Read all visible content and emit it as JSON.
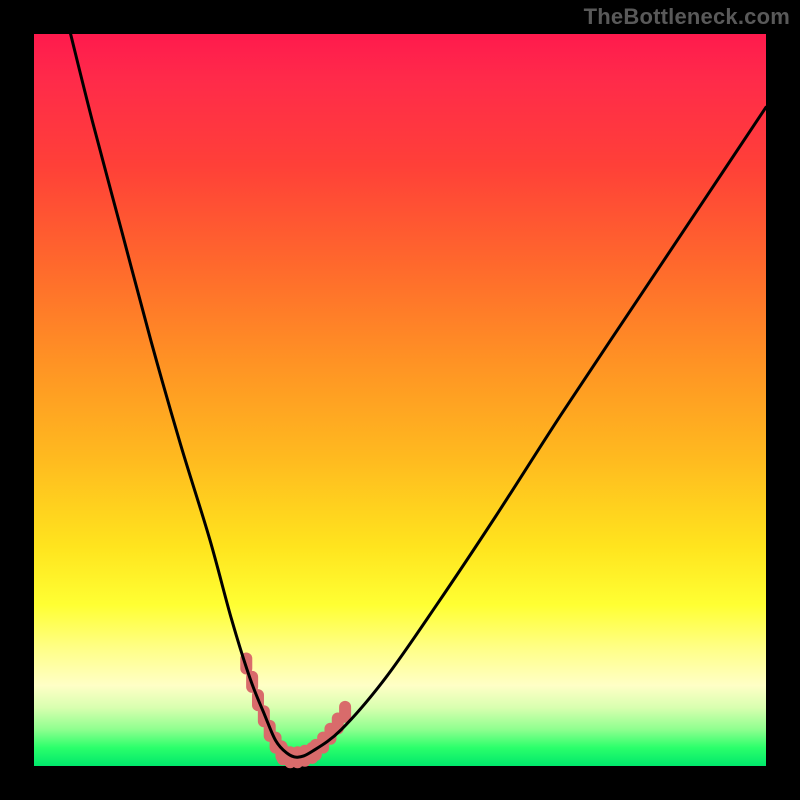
{
  "watermark": "TheBottleneck.com",
  "chart_data": {
    "type": "line",
    "title": "",
    "xlabel": "",
    "ylabel": "",
    "xlim": [
      0,
      100
    ],
    "ylim": [
      0,
      100
    ],
    "series": [
      {
        "name": "bottleneck-curve",
        "x": [
          5,
          8,
          12,
          16,
          20,
          24,
          27,
          29.5,
          31.5,
          33,
          34.5,
          36,
          38,
          42,
          48,
          55,
          63,
          72,
          82,
          92,
          100
        ],
        "y": [
          100,
          88,
          73,
          58,
          44,
          31,
          20,
          12,
          7,
          3.5,
          1.8,
          1.2,
          2.0,
          5,
          12,
          22,
          34,
          48,
          63,
          78,
          90
        ]
      }
    ],
    "markers": [
      {
        "name": "highlight-left-arm",
        "points": [
          {
            "x": 29.0,
            "y": 14.0
          },
          {
            "x": 29.8,
            "y": 11.5
          },
          {
            "x": 30.6,
            "y": 9.0
          },
          {
            "x": 31.4,
            "y": 6.8
          },
          {
            "x": 32.2,
            "y": 4.8
          },
          {
            "x": 33.0,
            "y": 3.2
          },
          {
            "x": 33.8,
            "y": 2.0
          }
        ]
      },
      {
        "name": "highlight-bottom",
        "points": [
          {
            "x": 34.0,
            "y": 1.6
          },
          {
            "x": 35.0,
            "y": 1.2
          },
          {
            "x": 36.0,
            "y": 1.2
          },
          {
            "x": 37.0,
            "y": 1.4
          },
          {
            "x": 38.0,
            "y": 1.8
          }
        ]
      },
      {
        "name": "highlight-right-arm",
        "points": [
          {
            "x": 38.5,
            "y": 2.2
          },
          {
            "x": 39.5,
            "y": 3.2
          },
          {
            "x": 40.5,
            "y": 4.4
          },
          {
            "x": 41.5,
            "y": 5.8
          },
          {
            "x": 42.5,
            "y": 7.4
          }
        ]
      }
    ],
    "colors": {
      "curve": "#000000",
      "marker": "#d96b6b",
      "background_top": "#ff1a4d",
      "background_bottom": "#00e86b"
    }
  }
}
